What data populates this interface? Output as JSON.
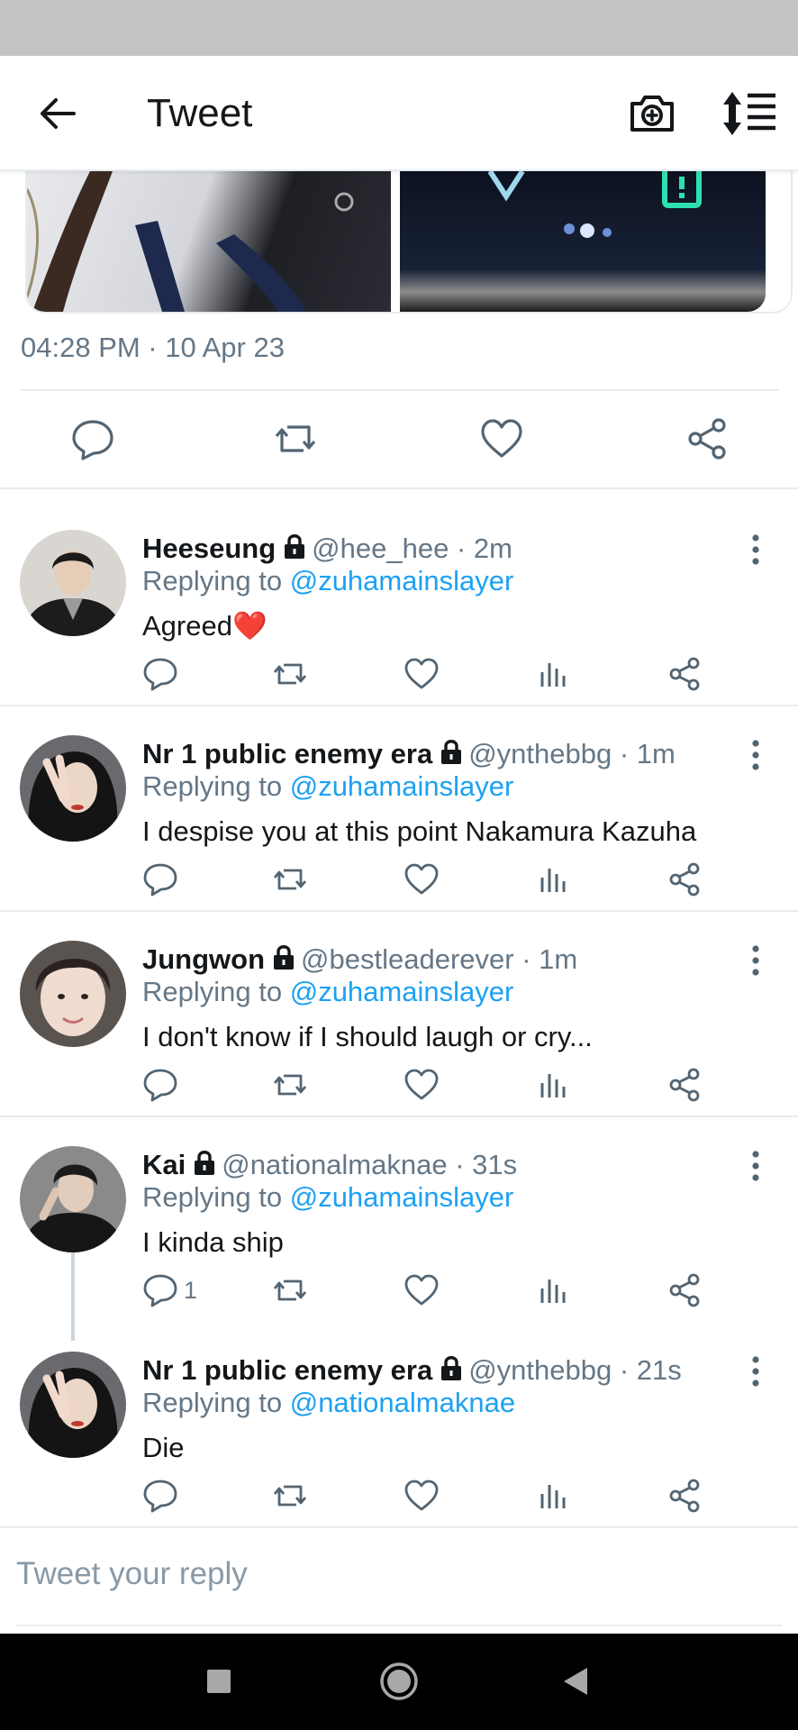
{
  "header": {
    "title": "Tweet"
  },
  "tweet": {
    "timestamp": "04:28 PM · 10 Apr 23"
  },
  "replies": [
    {
      "name": "Heeseung",
      "meta": "@hee_hee · 2m",
      "replying_prefix": "Replying to ",
      "replying_to": "@zuhamainslayer",
      "text": "Agreed",
      "emoji": "❤️",
      "reply_count": ""
    },
    {
      "name": "Nr 1 public enemy era",
      "meta": "@ynthebbg · 1m",
      "replying_prefix": "Replying to ",
      "replying_to": "@zuhamainslayer",
      "text": "I despise you at this point Nakamura Kazuha",
      "reply_count": ""
    },
    {
      "name": "Jungwon",
      "meta": "@bestleaderever · 1m",
      "replying_prefix": "Replying to ",
      "replying_to": "@zuhamainslayer",
      "text": "I don't know if I should laugh or cry...",
      "reply_count": ""
    },
    {
      "name": "Kai",
      "meta": "@nationalmaknae · 31s",
      "replying_prefix": "Replying to ",
      "replying_to": "@zuhamainslayer",
      "text": "I kinda ship",
      "reply_count": "1"
    },
    {
      "name": "Nr 1 public enemy era",
      "meta": "@ynthebbg · 21s",
      "replying_prefix": "Replying to ",
      "replying_to": "@nationalmaknae",
      "text": "Die",
      "reply_count": ""
    }
  ],
  "compose": {
    "placeholder": "Tweet your reply"
  },
  "colors": {
    "accent": "#1da1f2",
    "secondary_text": "#657786",
    "divider": "#e6ecf0",
    "heart_emoji": "#e0245e"
  },
  "icons": {
    "header": [
      "back-arrow-icon",
      "camera-plus-icon",
      "sort-icon"
    ],
    "tweet_actions": [
      "reply-icon",
      "retweet-icon",
      "like-icon",
      "share-icon"
    ],
    "reply_actions": [
      "reply-icon",
      "retweet-icon",
      "like-icon",
      "stats-icon",
      "share-icon"
    ],
    "reply_meta": [
      "lock-icon",
      "more-vertical-icon"
    ],
    "navigation": [
      "recents-square-icon",
      "home-circle-icon",
      "back-triangle-icon"
    ]
  }
}
